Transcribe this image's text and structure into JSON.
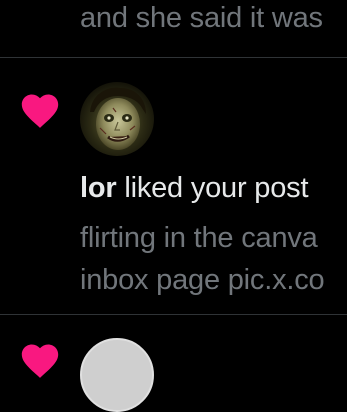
{
  "previous_item": {
    "text": "and she said it was"
  },
  "notification": {
    "icon": "heart-icon",
    "icon_color": "#f91880",
    "username": "lor",
    "action_text": "liked your post",
    "post_snippet_line1": "flirting in the canva",
    "post_snippet_line2": "inbox page pic.x.co"
  },
  "next_item": {
    "icon": "heart-icon",
    "icon_color": "#f91880"
  },
  "colors": {
    "background": "#000000",
    "primary_text": "#e7e9ea",
    "secondary_text": "#71767b",
    "divider": "#2f3336",
    "like": "#f91880"
  }
}
